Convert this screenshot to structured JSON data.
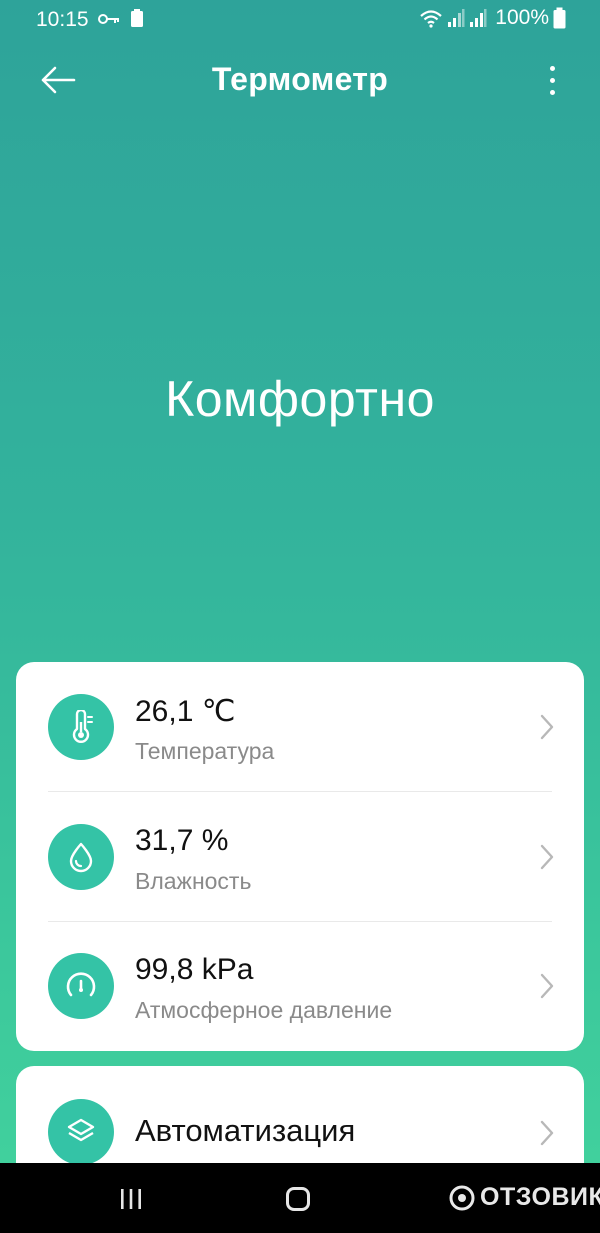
{
  "status_bar": {
    "time": "10:15",
    "battery_percent": "100%",
    "icons": [
      "key-icon",
      "battery-saver-icon",
      "wifi-icon",
      "signal-icon",
      "signal-icon",
      "battery-icon"
    ]
  },
  "toolbar": {
    "title": "Термометр",
    "back_icon": "arrow-left-icon",
    "more_icon": "more-vertical-icon"
  },
  "comfort_status": "Комфортно",
  "sensors": [
    {
      "value": "26,1 ℃",
      "label": "Температура",
      "icon": "thermometer-icon"
    },
    {
      "value": "31,7 %",
      "label": "Влажность",
      "icon": "water-drop-icon"
    },
    {
      "value": "99,8 kPa",
      "label": "Атмосферное давление",
      "icon": "gauge-icon"
    }
  ],
  "automation": {
    "label": "Автоматизация",
    "icon": "layers-icon"
  },
  "watermark": "ОТЗОВИК",
  "colors": {
    "accent": "#34c3a6",
    "gradient_top": "#2ea39a",
    "gradient_bottom": "#41d09d"
  }
}
